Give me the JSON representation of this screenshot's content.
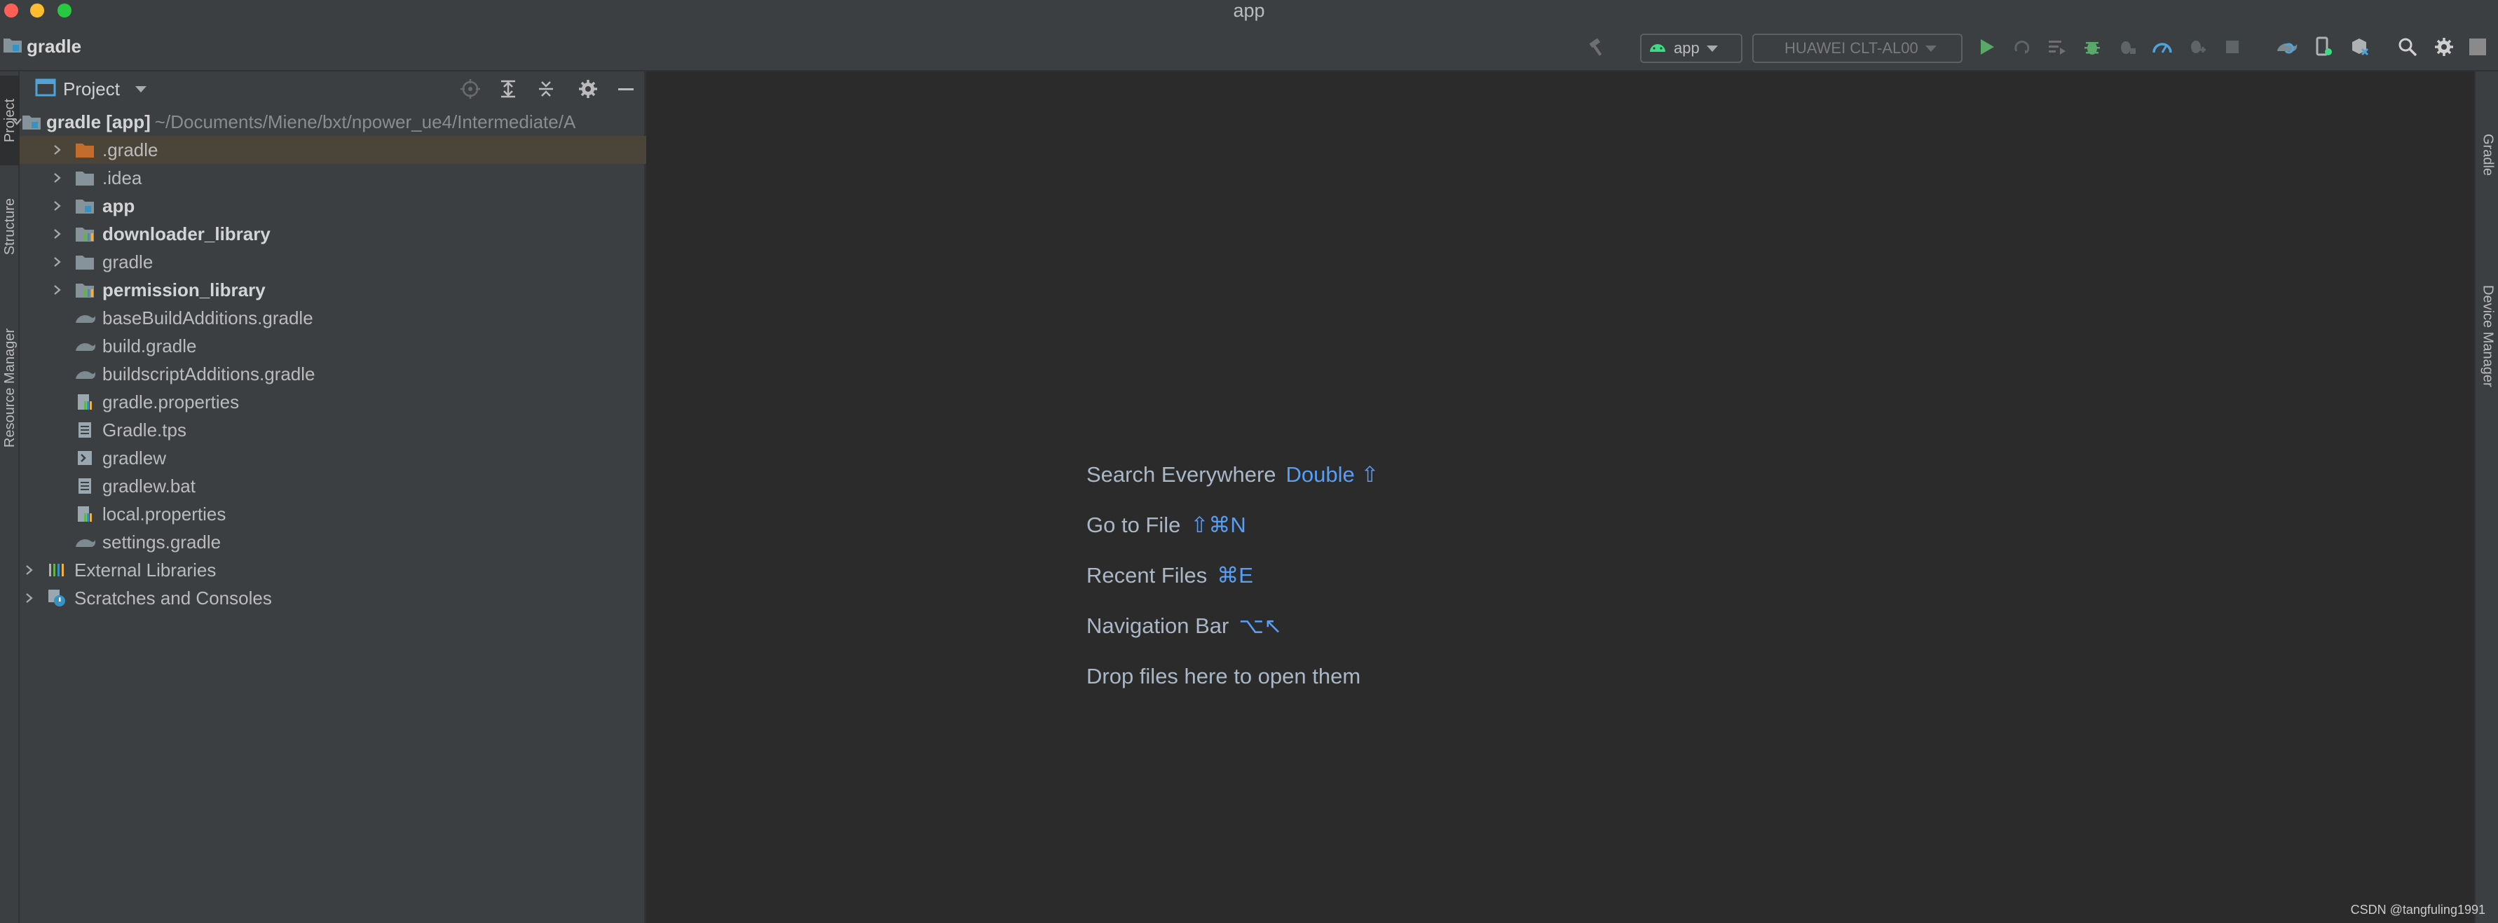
{
  "window": {
    "title": "app"
  },
  "toolbar": {
    "breadcrumb": "gradle",
    "run_config": "app",
    "device": "HUAWEI CLT-AL00"
  },
  "left_strip": {
    "tabs": [
      "Project",
      "Structure",
      "Resource Manager"
    ]
  },
  "project_panel": {
    "title": "Project",
    "root": {
      "name": "gradle [app]",
      "path": "~/Documents/Miene/bxt/npower_ue4/Intermediate/A"
    },
    "items": [
      {
        "label": ".gradle",
        "type": "folder-orange",
        "expandable": true,
        "bold": false
      },
      {
        "label": ".idea",
        "type": "folder",
        "expandable": true,
        "bold": false
      },
      {
        "label": "app",
        "type": "module",
        "expandable": true,
        "bold": true
      },
      {
        "label": "downloader_library",
        "type": "module-lib",
        "expandable": true,
        "bold": true
      },
      {
        "label": "gradle",
        "type": "folder",
        "expandable": true,
        "bold": false
      },
      {
        "label": "permission_library",
        "type": "module-lib",
        "expandable": true,
        "bold": true
      },
      {
        "label": "baseBuildAdditions.gradle",
        "type": "gradle-file",
        "expandable": false,
        "bold": false
      },
      {
        "label": "build.gradle",
        "type": "gradle-file",
        "expandable": false,
        "bold": false
      },
      {
        "label": "buildscriptAdditions.gradle",
        "type": "gradle-file",
        "expandable": false,
        "bold": false
      },
      {
        "label": "gradle.properties",
        "type": "properties-file",
        "expandable": false,
        "bold": false
      },
      {
        "label": "Gradle.tps",
        "type": "text-file",
        "expandable": false,
        "bold": false
      },
      {
        "label": "gradlew",
        "type": "shell-file",
        "expandable": false,
        "bold": false
      },
      {
        "label": "gradlew.bat",
        "type": "text-file",
        "expandable": false,
        "bold": false
      },
      {
        "label": "local.properties",
        "type": "properties-file",
        "expandable": false,
        "bold": false
      },
      {
        "label": "settings.gradle",
        "type": "gradle-file",
        "expandable": false,
        "bold": false
      }
    ],
    "external_libraries": "External Libraries",
    "scratches": "Scratches and Consoles"
  },
  "editor": {
    "hints": [
      {
        "label": "Search Everywhere",
        "key": "Double ⇧"
      },
      {
        "label": "Go to File",
        "key": "⇧⌘N"
      },
      {
        "label": "Recent Files",
        "key": "⌘E"
      },
      {
        "label": "Navigation Bar",
        "key": "⌥↖"
      },
      {
        "label": "Drop files here to open them",
        "key": ""
      }
    ]
  },
  "right_strip": {
    "tabs": [
      "Gradle",
      "Device Manager"
    ]
  },
  "watermark": "CSDN @tangfuling1991",
  "colors": {
    "background": "#2b2b2b",
    "panel": "#3c3f41",
    "selection": "#4a4439",
    "shortcut": "#589df6",
    "run_green": "#59a869"
  }
}
